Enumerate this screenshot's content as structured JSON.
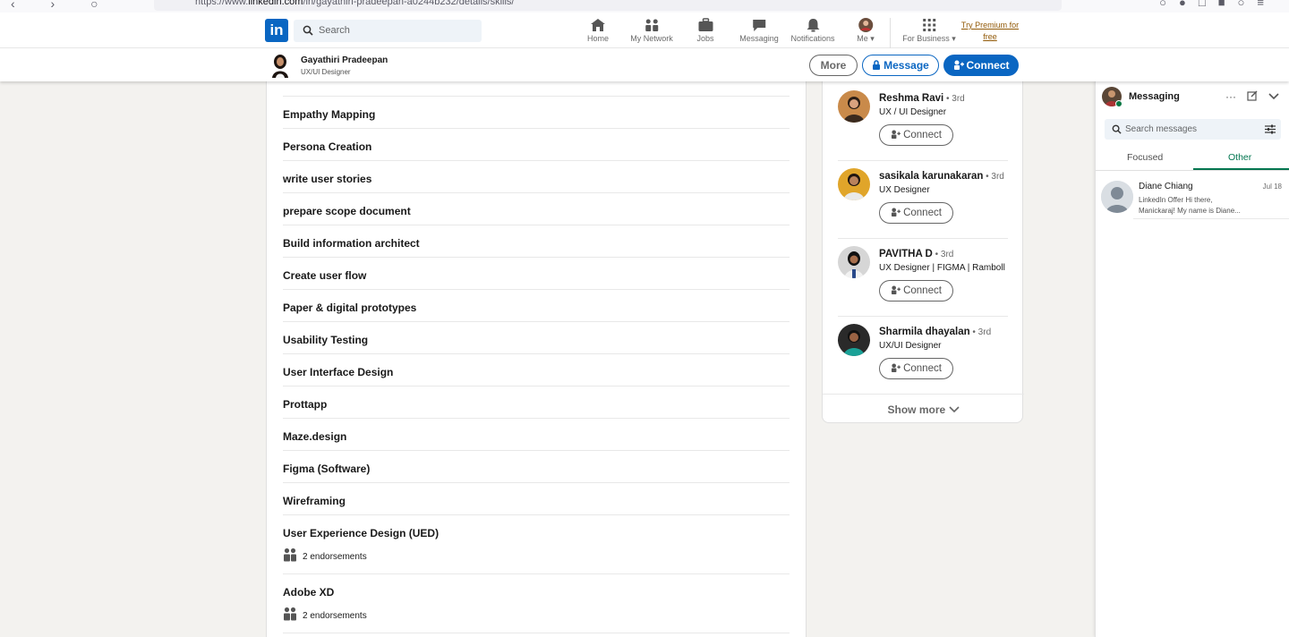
{
  "browser": {
    "url_prefix": "https://www.",
    "url_host": "linkedin.com",
    "url_path": "/in/gayathiri-pradeepan-a0244b232/details/skills/"
  },
  "nav": {
    "search_placeholder": "Search",
    "items": [
      "Home",
      "My Network",
      "Jobs",
      "Messaging",
      "Notifications",
      "Me",
      "For Business"
    ],
    "premium_line1": "Try Premium for",
    "premium_line2": "free"
  },
  "profile": {
    "name": "Gayathiri Pradeepan",
    "headline": "UX/UI Designer",
    "more_label": "More",
    "message_label": "Message",
    "connect_label": "Connect"
  },
  "skills": [
    {
      "name": "Empathy Mapping"
    },
    {
      "name": "Persona Creation"
    },
    {
      "name": "write user stories"
    },
    {
      "name": "prepare scope document"
    },
    {
      "name": "Build information architect"
    },
    {
      "name": "Create user flow"
    },
    {
      "name": "Paper & digital prototypes"
    },
    {
      "name": "Usability Testing"
    },
    {
      "name": "User Interface Design"
    },
    {
      "name": "Prottapp"
    },
    {
      "name": "Maze.design"
    },
    {
      "name": "Figma (Software)"
    },
    {
      "name": "Wireframing"
    },
    {
      "name": "User Experience Design (UED)",
      "endorsements": "2 endorsements"
    },
    {
      "name": "Adobe XD",
      "endorsements": "2 endorsements"
    }
  ],
  "people": [
    {
      "name": "Reshma Ravi",
      "degree": " • 3rd",
      "headline": "UX / UI Designer",
      "connect": "Connect"
    },
    {
      "name": "sasikala karunakaran",
      "degree": " • 3rd",
      "headline": "UX Designer",
      "connect": "Connect"
    },
    {
      "name": "PAVITHA D",
      "degree": " • 3rd",
      "headline": "UX Designer | FIGMA | Ramboll",
      "connect": "Connect"
    },
    {
      "name": "Sharmila dhayalan",
      "degree": " • 3rd",
      "headline": "UX/UI Designer",
      "connect": "Connect"
    }
  ],
  "show_more": "Show more",
  "messaging": {
    "title": "Messaging",
    "search_placeholder": "Search messages",
    "tab_focused": "Focused",
    "tab_other": "Other",
    "conversations": [
      {
        "name": "Diane Chiang",
        "date": "Jul 18",
        "preview_line1": "LinkedIn Offer  Hi there,",
        "preview_line2": "Manickaraj! My name is Diane..."
      }
    ]
  },
  "colors": {
    "brand": "#0a66c2",
    "premium": "#915907",
    "messaging_active": "#01754f"
  }
}
